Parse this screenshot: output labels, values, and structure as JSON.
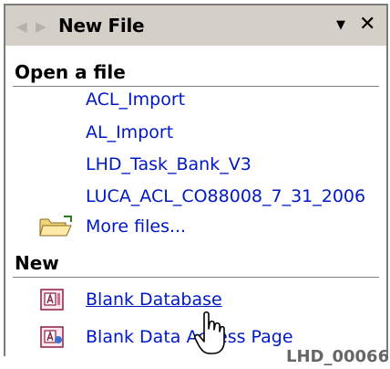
{
  "pane": {
    "title": "New File",
    "back_icon": "arrow-left-icon",
    "forward_icon": "arrow-right-icon",
    "dropdown_icon": "triangle-down-icon",
    "close_icon": "close-icon"
  },
  "open_section": {
    "heading": "Open a file",
    "files": [
      "ACL_Import",
      "AL_Import",
      "LHD_Task_Bank_V3",
      "LUCA_ACL_CO88008_7_31_2006"
    ],
    "more_label": "More files...",
    "more_icon": "open-folder-icon"
  },
  "new_section": {
    "heading": "New",
    "items": [
      {
        "label": "Blank Database",
        "icon": "access-database-icon"
      },
      {
        "label": "Blank Data Access Page",
        "icon": "data-access-page-icon"
      }
    ]
  },
  "watermark": "LHD_00066",
  "colors": {
    "link": "#0019c8",
    "titlebar": "#d4d0c8",
    "rule": "#808080"
  }
}
